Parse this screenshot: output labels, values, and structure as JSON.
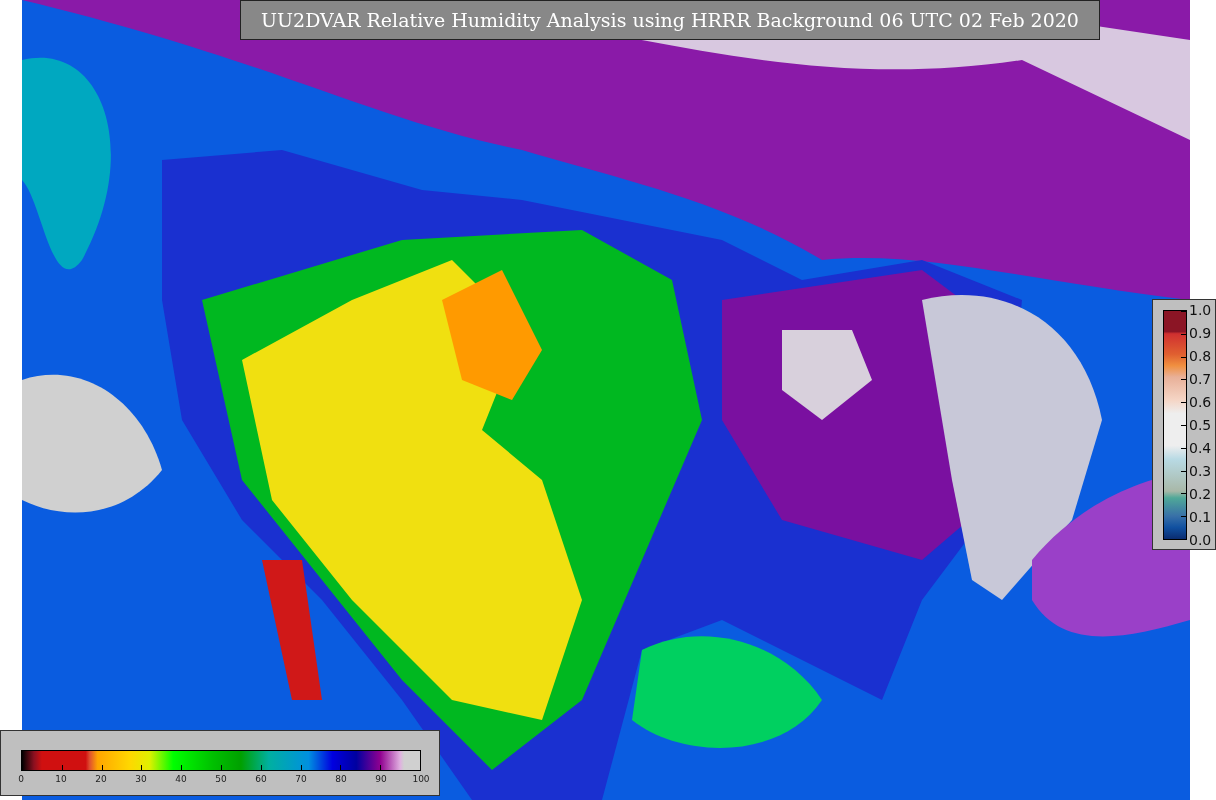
{
  "title": "UU2DVAR Relative Humidity Analysis using HRRR Background 06 UTC 02 Feb 2020",
  "colorbars": [
    {
      "kind": "horizontal",
      "ticks": [
        "0",
        "10",
        "20",
        "30",
        "40",
        "50",
        "60",
        "70",
        "80",
        "90",
        "100"
      ]
    },
    {
      "kind": "vertical",
      "ticks": [
        "1.0",
        "0.9",
        "0.8",
        "0.7",
        "0.6",
        "0.5",
        "0.4",
        "0.3",
        "0.2",
        "0.1",
        "0.0"
      ]
    }
  ]
}
